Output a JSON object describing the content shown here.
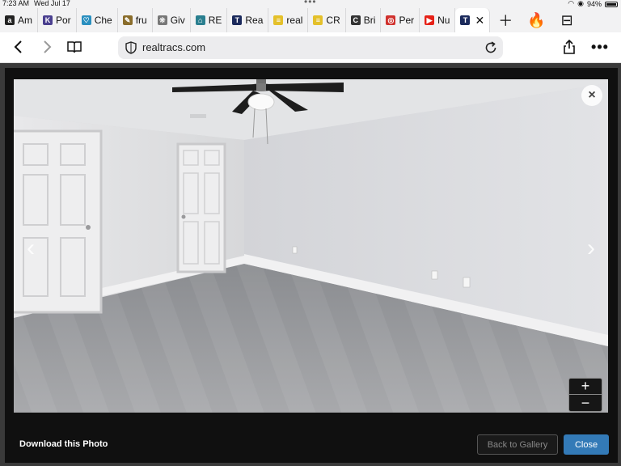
{
  "status": {
    "time": "7:23 AM",
    "date": "Wed Jul 17",
    "battery": "94%"
  },
  "tabs": [
    {
      "label": "Am",
      "icon": "amazon-icon",
      "color": "#222222",
      "glyph": "a"
    },
    {
      "label": "Por",
      "icon": "portal-icon",
      "color": "#4a3f8f",
      "glyph": "K"
    },
    {
      "label": "Che",
      "icon": "heart-icon",
      "color": "#2a8fbf",
      "glyph": "♡"
    },
    {
      "label": "fru",
      "icon": "fruit-icon",
      "color": "#8a6d2b",
      "glyph": "✎"
    },
    {
      "label": "Giv",
      "icon": "give-icon",
      "color": "#777777",
      "glyph": "❊"
    },
    {
      "label": "RE",
      "icon": "home-icon",
      "color": "#2a7f8f",
      "glyph": "⌂"
    },
    {
      "label": "Rea",
      "icon": "realtracs-icon",
      "color": "#1b2a5c",
      "glyph": "T"
    },
    {
      "label": "real",
      "icon": "realtor-icon",
      "color": "#e4c02a",
      "glyph": "≡"
    },
    {
      "label": "CR",
      "icon": "cr-icon",
      "color": "#e4c02a",
      "glyph": "≡"
    },
    {
      "label": "Bri",
      "icon": "bri-icon",
      "color": "#333333",
      "glyph": "C"
    },
    {
      "label": "Per",
      "icon": "target-icon",
      "color": "#d0312d",
      "glyph": "◎"
    },
    {
      "label": "Nu",
      "icon": "youtube-icon",
      "color": "#e62117",
      "glyph": "▶"
    }
  ],
  "active_tab": {
    "icon": "realtracs-icon",
    "glyph": "T"
  },
  "url": "realtracs.com",
  "modal": {
    "download_label": "Download this Photo",
    "back_label": "Back to Gallery",
    "close_label": "Close",
    "zoom_in": "+",
    "zoom_out": "−",
    "prev": "‹",
    "next": "›",
    "close_x": "×"
  },
  "colors": {
    "close_button": "#337ab7"
  }
}
